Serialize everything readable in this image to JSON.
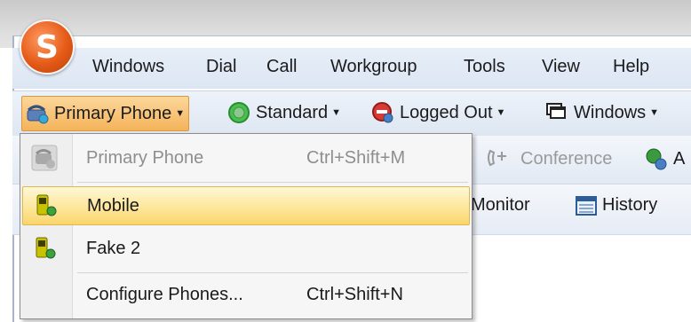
{
  "menubar": {
    "items": [
      {
        "label": "Windows"
      },
      {
        "label": "Dial"
      },
      {
        "label": "Call"
      },
      {
        "label": "Workgroup"
      },
      {
        "label": "Tools"
      },
      {
        "label": "View"
      },
      {
        "label": "Help"
      }
    ]
  },
  "toolbar": {
    "primary_phone": "Primary Phone",
    "standard": "Standard",
    "logged_out": "Logged Out",
    "windows": "Windows"
  },
  "toolbar_secondary": {
    "conference": "Conference",
    "conference_trailing": "A",
    "monitor": "Monitor",
    "history": "History"
  },
  "dropdown": {
    "items": [
      {
        "label": "Primary Phone",
        "shortcut": "Ctrl+Shift+M",
        "state": "disabled",
        "icon": "phone-icon"
      },
      {
        "label": "Mobile",
        "shortcut": "",
        "state": "highlighted",
        "icon": "mobile-phone-icon"
      },
      {
        "label": "Fake 2",
        "shortcut": "",
        "state": "normal",
        "icon": "mobile-phone-icon"
      },
      {
        "label": "Configure Phones...",
        "shortcut": "Ctrl+Shift+N",
        "state": "normal",
        "icon": ""
      }
    ]
  },
  "colors": {
    "active_button": "#f5b35a",
    "menu_highlight": "#fde79b",
    "toolbar_bg": "#dde6f2",
    "logo": "#e55a17"
  }
}
